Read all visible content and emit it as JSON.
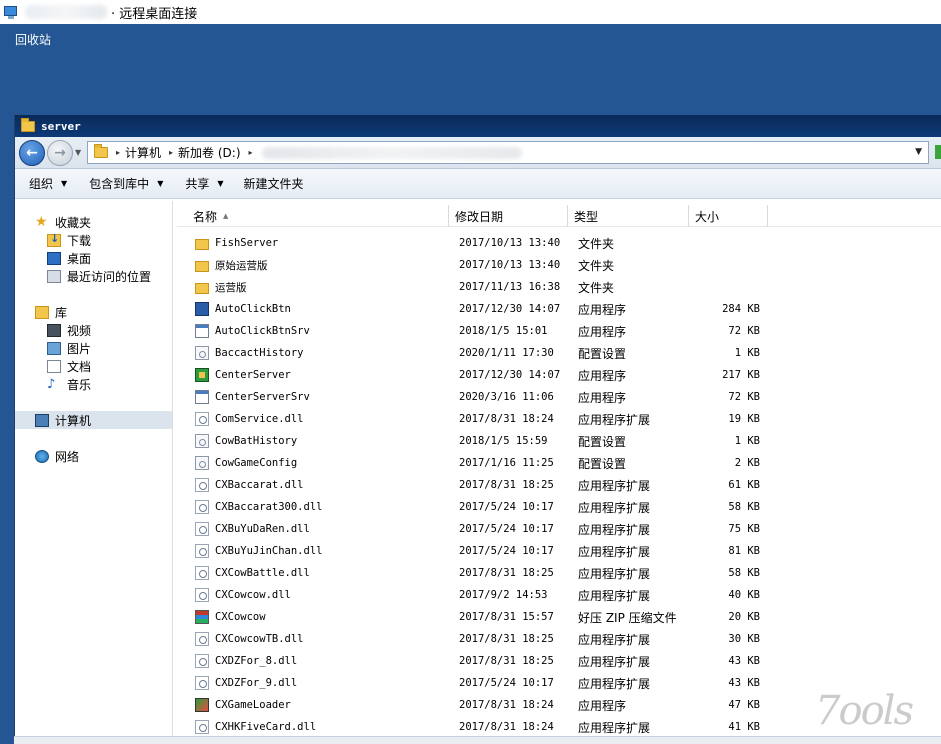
{
  "rdp": {
    "title": "· 远程桌面连接"
  },
  "desktop": {
    "recycle_bin_label": "回收站"
  },
  "window": {
    "title": "server"
  },
  "address": {
    "crumbs": [
      "计算机",
      "新加卷 (D:)"
    ]
  },
  "toolbar": {
    "organize": "组织",
    "include_in_library": "包含到库中",
    "share": "共享",
    "new_folder": "新建文件夹"
  },
  "nav": {
    "favorites": "收藏夹",
    "downloads": "下载",
    "desktop": "桌面",
    "recent": "最近访问的位置",
    "libraries": "库",
    "videos": "视频",
    "pictures": "图片",
    "documents": "文档",
    "music": "音乐",
    "computer": "计算机",
    "network": "网络"
  },
  "columns": {
    "name": "名称",
    "date": "修改日期",
    "type": "类型",
    "size": "大小"
  },
  "files": [
    {
      "name": "FishServer",
      "date": "2017/10/13 13:40",
      "type": "文件夹",
      "size": "",
      "icon": "folder-icon"
    },
    {
      "name": "原始运营版",
      "date": "2017/10/13 13:40",
      "type": "文件夹",
      "size": "",
      "icon": "folder-icon"
    },
    {
      "name": "运营版",
      "date": "2017/11/13 16:38",
      "type": "文件夹",
      "size": "",
      "icon": "folder-icon"
    },
    {
      "name": "AutoClickBtn",
      "date": "2017/12/30 14:07",
      "type": "应用程序",
      "size": "284 KB",
      "icon": "app-icon"
    },
    {
      "name": "AutoClickBtnSrv",
      "date": "2018/1/5 15:01",
      "type": "应用程序",
      "size": "72 KB",
      "icon": "window-app-icon"
    },
    {
      "name": "BaccactHistory",
      "date": "2020/1/11 17:30",
      "type": "配置设置",
      "size": "1 KB",
      "icon": "config-icon"
    },
    {
      "name": "CenterServer",
      "date": "2017/12/30 14:07",
      "type": "应用程序",
      "size": "217 KB",
      "icon": "server-app-icon"
    },
    {
      "name": "CenterServerSrv",
      "date": "2020/3/16 11:06",
      "type": "应用程序",
      "size": "72 KB",
      "icon": "window-app-icon"
    },
    {
      "name": "ComService.dll",
      "date": "2017/8/31 18:24",
      "type": "应用程序扩展",
      "size": "19 KB",
      "icon": "dll-icon"
    },
    {
      "name": "CowBatHistory",
      "date": "2018/1/5 15:59",
      "type": "配置设置",
      "size": "1 KB",
      "icon": "config-icon"
    },
    {
      "name": "CowGameConfig",
      "date": "2017/1/16 11:25",
      "type": "配置设置",
      "size": "2 KB",
      "icon": "config-icon"
    },
    {
      "name": "CXBaccarat.dll",
      "date": "2017/8/31 18:25",
      "type": "应用程序扩展",
      "size": "61 KB",
      "icon": "dll-icon"
    },
    {
      "name": "CXBaccarat300.dll",
      "date": "2017/5/24 10:17",
      "type": "应用程序扩展",
      "size": "58 KB",
      "icon": "dll-icon"
    },
    {
      "name": "CXBuYuDaRen.dll",
      "date": "2017/5/24 10:17",
      "type": "应用程序扩展",
      "size": "75 KB",
      "icon": "dll-icon"
    },
    {
      "name": "CXBuYuJinChan.dll",
      "date": "2017/5/24 10:17",
      "type": "应用程序扩展",
      "size": "81 KB",
      "icon": "dll-icon"
    },
    {
      "name": "CXCowBattle.dll",
      "date": "2017/8/31 18:25",
      "type": "应用程序扩展",
      "size": "58 KB",
      "icon": "dll-icon"
    },
    {
      "name": "CXCowcow.dll",
      "date": "2017/9/2 14:53",
      "type": "应用程序扩展",
      "size": "40 KB",
      "icon": "dll-icon"
    },
    {
      "name": "CXCowcow",
      "date": "2017/8/31 15:57",
      "type": "好压 ZIP 压缩文件",
      "size": "20 KB",
      "icon": "zip-icon"
    },
    {
      "name": "CXCowcowTB.dll",
      "date": "2017/8/31 18:25",
      "type": "应用程序扩展",
      "size": "30 KB",
      "icon": "dll-icon"
    },
    {
      "name": "CXDZFor_8.dll",
      "date": "2017/8/31 18:25",
      "type": "应用程序扩展",
      "size": "43 KB",
      "icon": "dll-icon"
    },
    {
      "name": "CXDZFor_9.dll",
      "date": "2017/5/24 10:17",
      "type": "应用程序扩展",
      "size": "43 KB",
      "icon": "dll-icon"
    },
    {
      "name": "CXGameLoader",
      "date": "2017/8/31 18:24",
      "type": "应用程序",
      "size": "47 KB",
      "icon": "game-app-icon"
    },
    {
      "name": "CXHKFiveCard.dll",
      "date": "2017/8/31 18:24",
      "type": "应用程序扩展",
      "size": "41 KB",
      "icon": "dll-icon"
    }
  ],
  "watermark": "7ools"
}
